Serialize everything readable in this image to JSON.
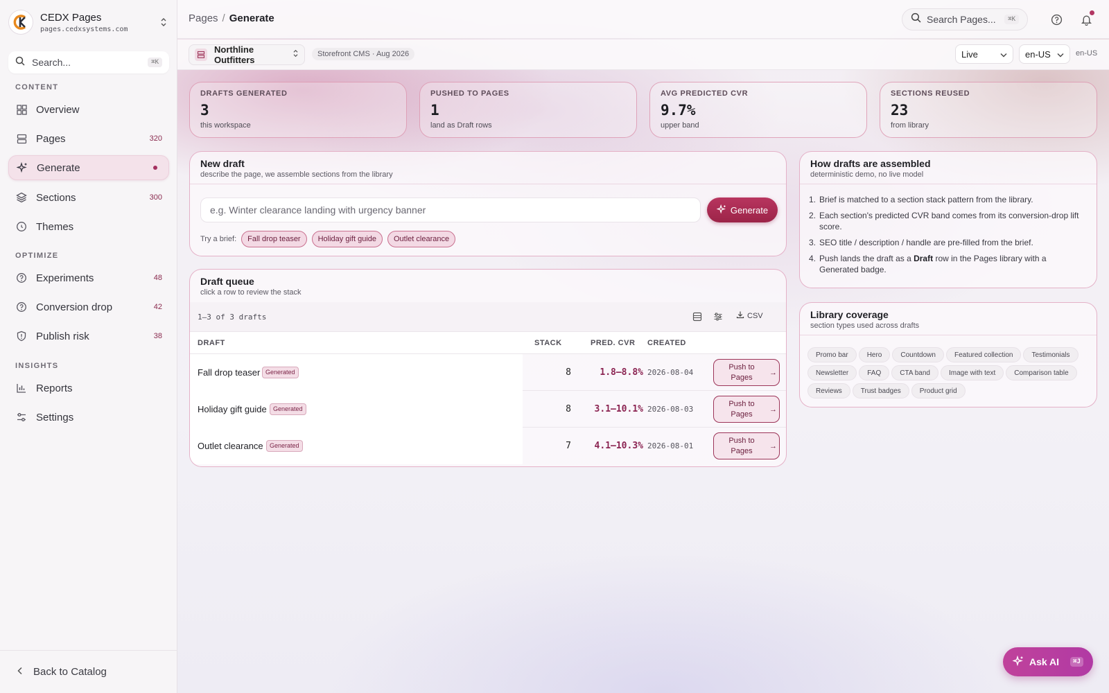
{
  "brand": {
    "name": "CEDX Pages",
    "domain": "pages.cedxsystems.com"
  },
  "sidebar": {
    "search_placeholder": "Search...",
    "search_kbd": "⌘K",
    "sections": [
      {
        "label": "CONTENT",
        "items": [
          {
            "label": "Overview",
            "count": "",
            "icon": "overview-icon"
          },
          {
            "label": "Pages",
            "count": "320",
            "icon": "pages-icon"
          },
          {
            "label": "Generate",
            "count": "",
            "icon": "sparkle-icon",
            "active": true
          },
          {
            "label": "Sections",
            "count": "300",
            "icon": "layers-icon"
          },
          {
            "label": "Themes",
            "count": "",
            "icon": "palette-icon"
          }
        ]
      },
      {
        "label": "OPTIMIZE",
        "items": [
          {
            "label": "Experiments",
            "count": "48",
            "icon": "help-circle-icon"
          },
          {
            "label": "Conversion drop",
            "count": "42",
            "icon": "help-circle-icon"
          },
          {
            "label": "Publish risk",
            "count": "38",
            "icon": "shield-icon"
          }
        ]
      },
      {
        "label": "INSIGHTS",
        "items": [
          {
            "label": "Reports",
            "count": "",
            "icon": "bar-chart-icon"
          },
          {
            "label": "Settings",
            "count": "",
            "icon": "sliders-icon"
          }
        ]
      }
    ],
    "footer_label": "Back to Catalog"
  },
  "topbar": {
    "breadcrumb_root": "Pages",
    "breadcrumb_sep": "/",
    "breadcrumb_current": "Generate",
    "search_placeholder": "Search Pages...",
    "search_kbd": "⌘K"
  },
  "subbar": {
    "workspace": "Northline Outfitters",
    "meta": "Storefront CMS · Aug 2026",
    "env": "Live",
    "locale": "en-US",
    "locale_tag": "en-US"
  },
  "stats": [
    {
      "label": "DRAFTS GENERATED",
      "value": "3",
      "sub": "this workspace"
    },
    {
      "label": "PUSHED TO PAGES",
      "value": "1",
      "sub": "land as Draft rows"
    },
    {
      "label": "AVG PREDICTED CVR",
      "value": "9.7%",
      "sub": "upper band"
    },
    {
      "label": "SECTIONS REUSED",
      "value": "23",
      "sub": "from library"
    }
  ],
  "new_draft": {
    "title": "New draft",
    "subtitle": "describe the page, we assemble sections from the library",
    "input_placeholder": "e.g. Winter clearance landing with urgency banner",
    "generate_label": "Generate",
    "try_label": "Try a brief:",
    "briefs": [
      "Fall drop teaser",
      "Holiday gift guide",
      "Outlet clearance"
    ]
  },
  "queue": {
    "title": "Draft queue",
    "subtitle": "click a row to review the stack",
    "count": "1–3 of 3 drafts",
    "csv_label": "CSV",
    "columns": {
      "draft": "DRAFT",
      "stack": "STACK",
      "cvr": "PRED. CVR",
      "created": "CREATED"
    },
    "push_label": "Push to Pages",
    "rows": [
      {
        "name": "Fall drop teaser",
        "badge": "Generated",
        "stack": "8",
        "cvr": "1.8–8.8%",
        "created": "2026-08-04"
      },
      {
        "name": "Holiday gift guide",
        "badge": "Generated",
        "stack": "8",
        "cvr": "3.1–10.1%",
        "created": "2026-08-03"
      },
      {
        "name": "Outlet clearance",
        "badge": "Generated",
        "stack": "7",
        "cvr": "4.1–10.3%",
        "created": "2026-08-01"
      }
    ]
  },
  "assembly": {
    "title": "How drafts are assembled",
    "subtitle": "deterministic demo, no live model",
    "steps": [
      {
        "n": "1.",
        "pre": "Brief is matched to a section stack pattern from the library.",
        "bold": "",
        "post": ""
      },
      {
        "n": "2.",
        "pre": "Each section's predicted CVR band comes from its conversion-drop lift score.",
        "bold": "",
        "post": ""
      },
      {
        "n": "3.",
        "pre": "SEO title / description / handle are pre-filled from the brief.",
        "bold": "",
        "post": ""
      },
      {
        "n": "4.",
        "pre": "Push lands the draft as a ",
        "bold": "Draft",
        "post": " row in the Pages library with a Generated badge."
      }
    ]
  },
  "coverage": {
    "title": "Library coverage",
    "subtitle": "section types used across drafts",
    "types": [
      "Promo bar",
      "Hero",
      "Countdown",
      "Featured collection",
      "Testimonials",
      "Newsletter",
      "FAQ",
      "CTA band",
      "Image with text",
      "Comparison table",
      "Reviews",
      "Trust badges",
      "Product grid"
    ]
  },
  "ask_ai": {
    "label": "Ask AI",
    "kbd": "⌘J"
  },
  "colors": {
    "accent": "#a8305a",
    "active_bg": "#f4e2ea",
    "ask_ai": "#b93ea0"
  }
}
